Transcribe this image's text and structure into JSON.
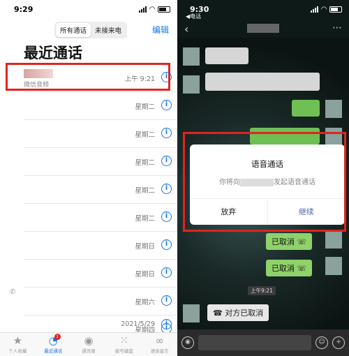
{
  "left": {
    "status_time": "9:29",
    "segments": [
      "所有通话",
      "未接来电"
    ],
    "edit_label": "编辑",
    "title": "最近通话",
    "rows": [
      {
        "sub": "微信音频",
        "day": "上午 9:21"
      },
      {
        "sub": "",
        "day": "星期二"
      },
      {
        "sub": "",
        "day": "星期二"
      },
      {
        "sub": "",
        "day": "星期二"
      },
      {
        "sub": "",
        "day": "星期二"
      },
      {
        "sub": "",
        "day": "星期二"
      },
      {
        "sub": "",
        "day": "星期日"
      },
      {
        "sub": "",
        "day": "星期日"
      },
      {
        "sub": "",
        "day": "星期六"
      },
      {
        "sub": "",
        "day": "星期四"
      },
      {
        "sub": "",
        "day": "2021/5/29"
      }
    ],
    "tabs": [
      {
        "label": "个人收藏",
        "icon": "★"
      },
      {
        "label": "最近通话",
        "icon": "◔",
        "badge": "1"
      },
      {
        "label": "通讯录",
        "icon": "◉"
      },
      {
        "label": "拨号键盘",
        "icon": "⁙"
      },
      {
        "label": "语音留言",
        "icon": "∞"
      }
    ]
  },
  "right": {
    "status_time": "9:30",
    "back_label": "◀电话",
    "dialog": {
      "title": "语音通话",
      "msg_before": "你将向",
      "msg_after": "发起语音通话",
      "cancel": "放弃",
      "confirm": "继续"
    },
    "cancelled_label_1": "已取消",
    "cancelled_label_2": "已取消",
    "time_chip": "上午9:21",
    "other_cancelled": "对方已取消"
  },
  "colors": {
    "accent": "#1677e6",
    "highlight": "#e1241f",
    "wechat_green": "#8fd16a"
  }
}
